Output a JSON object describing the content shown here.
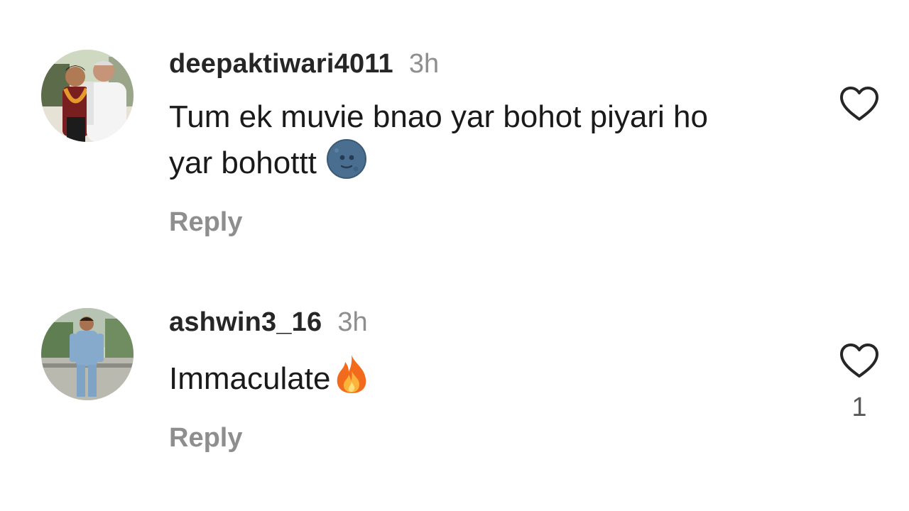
{
  "comments": [
    {
      "username": "deepaktiwari4011",
      "time": "3h",
      "text_line1": "Tum ek muvie bnao yar bohot piyari ho",
      "text_line2": "yar bohottt",
      "emoji": "new-moon-face-icon",
      "reply_label": "Reply",
      "like_count": ""
    },
    {
      "username": "ashwin3_16",
      "time": "3h",
      "text_line1": "Immaculate",
      "emoji": "fire-icon",
      "reply_label": "Reply",
      "like_count": "1"
    }
  ],
  "colors": {
    "username": "#262626",
    "muted": "#8e8e8e",
    "text": "#1a1a1a",
    "heart_stroke": "#262626"
  }
}
